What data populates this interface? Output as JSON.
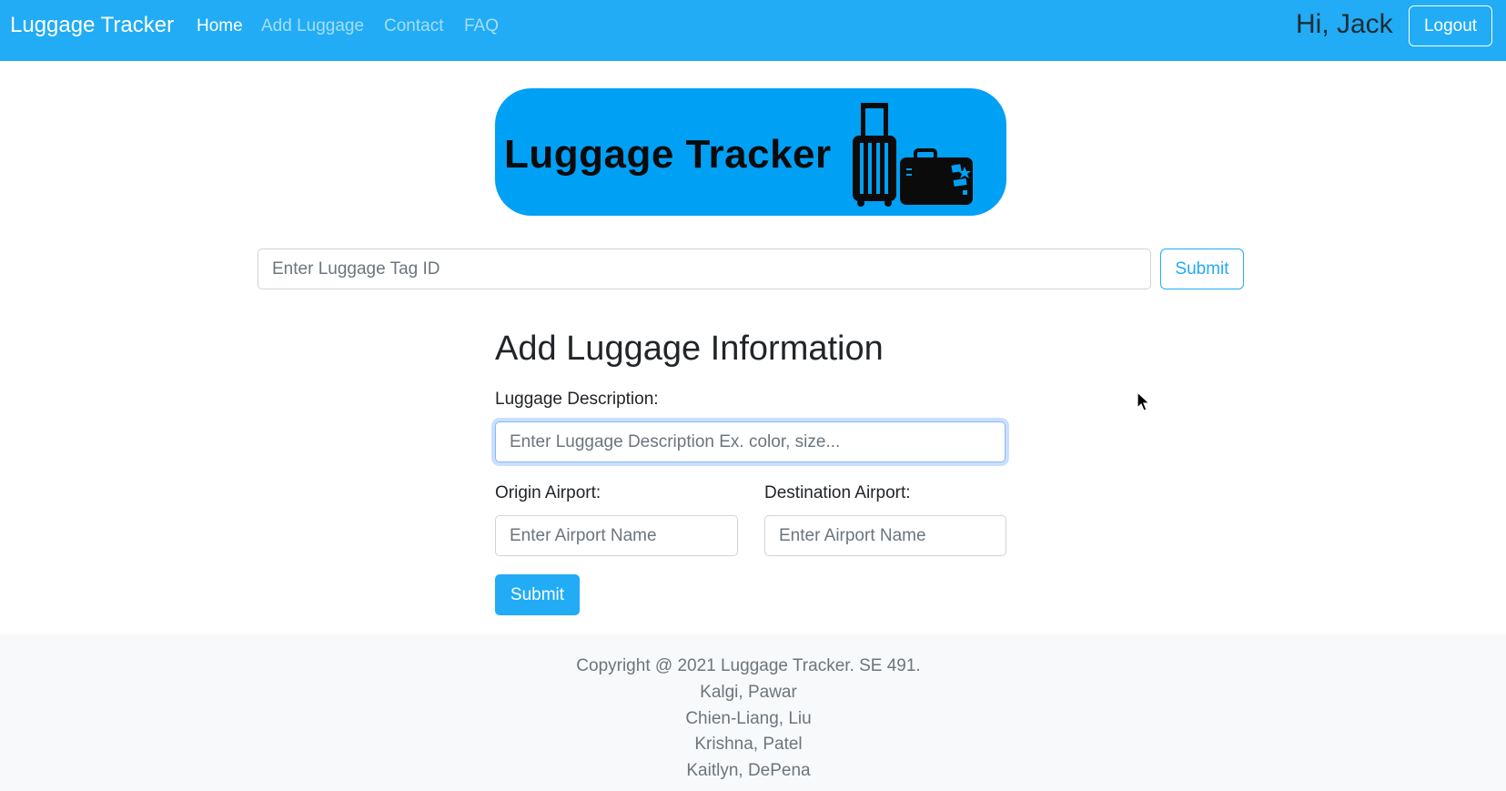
{
  "navbar": {
    "brand": "Luggage Tracker",
    "links": [
      "Home",
      "Add Luggage",
      "Contact",
      "FAQ"
    ],
    "active_link": "Home",
    "greeting": "Hi, Jack",
    "logout_label": "Logout"
  },
  "banner": {
    "title": "Luggage Tracker",
    "icon": "luggage-icon"
  },
  "tag_search": {
    "placeholder": "Enter Luggage Tag ID",
    "value": "",
    "submit_label": "Submit"
  },
  "form": {
    "title": "Add Luggage Information",
    "description_label": "Luggage Description:",
    "description_placeholder": "Enter Luggage Description Ex. color, size...",
    "origin_label": "Origin Airport:",
    "origin_placeholder": "Enter Airport Name",
    "destination_label": "Destination Airport:",
    "destination_placeholder": "Enter Airport Name",
    "submit_label": "Submit"
  },
  "footer": {
    "lines": [
      "Copyright @ 2021 Luggage Tracker. SE 491.",
      "Kalgi, Pawar",
      "Chien-Liang, Liu",
      "Krishna, Patel",
      "Kaitlyn, DePena"
    ]
  },
  "colors": {
    "navbar_bg": "#21acf5",
    "banner_bg": "#00a0f5",
    "primary_button": "#21acf5",
    "footer_bg": "#f8f9fa"
  }
}
